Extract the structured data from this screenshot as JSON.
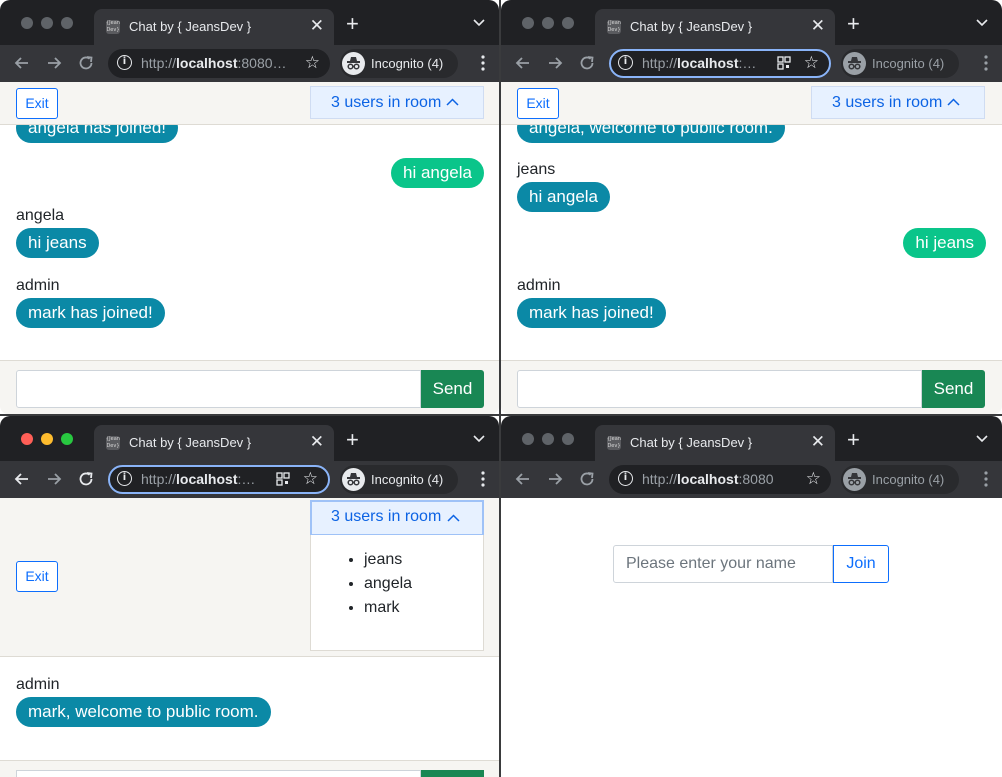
{
  "browser": {
    "tab_title": "Chat by { JeansDev }",
    "favicon_text": "{Jeans Dev}",
    "url_prefix": "http://",
    "url_host": "localhost",
    "url_port": ":8080",
    "url_truncated_1": ":8080…",
    "url_truncated_2": ":…",
    "incognito_label": "Incognito (4)",
    "close_glyph": "✕",
    "newtab_glyph": "+",
    "star_glyph": "☆",
    "info_glyph": "i"
  },
  "room": {
    "exit_label": "Exit",
    "users_label": "3 users in room",
    "users": [
      "jeans",
      "angela",
      "mark"
    ]
  },
  "window1": {
    "messages": [
      {
        "sender": "",
        "text": "angela has joined!",
        "mine": false
      },
      {
        "sender": "",
        "text": "hi angela",
        "mine": true
      },
      {
        "sender": "angela",
        "text": "hi jeans",
        "mine": false
      },
      {
        "sender": "admin",
        "text": "mark has joined!",
        "mine": false
      }
    ],
    "send_label": "Send"
  },
  "window2": {
    "messages": [
      {
        "sender": "",
        "text": "angela, welcome to public room.",
        "mine": false
      },
      {
        "sender": "jeans",
        "text": "hi angela",
        "mine": false
      },
      {
        "sender": "",
        "text": "hi jeans",
        "mine": true
      },
      {
        "sender": "admin",
        "text": "mark has joined!",
        "mine": false
      }
    ],
    "send_label": "Send"
  },
  "window3": {
    "messages": [
      {
        "sender": "admin",
        "text": "mark, welcome to public room.",
        "mine": false
      }
    ]
  },
  "window4": {
    "name_placeholder": "Please enter your name",
    "join_label": "Join"
  },
  "colors": {
    "other_bubble": "#0b89a6",
    "own_bubble": "#0ac58a",
    "send_button": "#198754",
    "primary": "#0d6efd"
  }
}
